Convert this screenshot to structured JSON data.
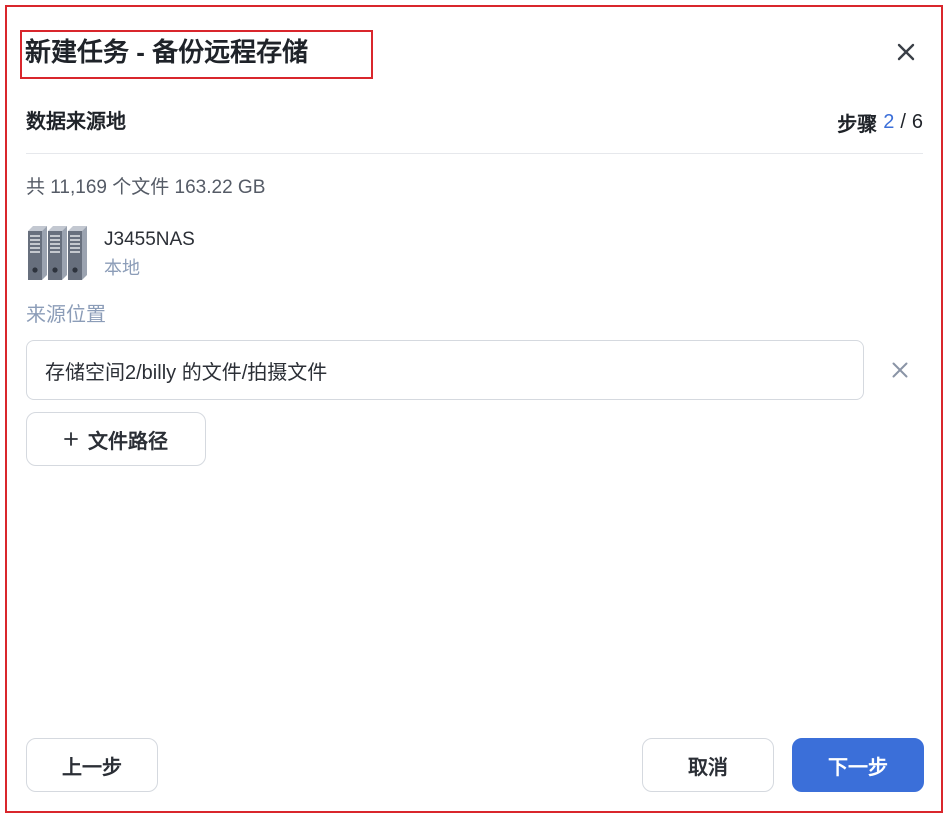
{
  "dialog": {
    "title": "新建任务 - 备份远程存储",
    "close_icon": "close-icon"
  },
  "section": {
    "title": "数据来源地",
    "step_label": "步骤",
    "step_current": "2",
    "step_separator": "/",
    "step_total": "6"
  },
  "summary": "共 11,169 个文件 163.22 GB",
  "device": {
    "icon": "nas-server-icon",
    "name": "J3455NAS",
    "type": "本地"
  },
  "source": {
    "label": "来源位置",
    "paths": [
      "存储空间2/billy 的文件/拍摄文件"
    ],
    "remove_icon": "close-icon",
    "add_icon": "plus-icon",
    "add_button": "文件路径"
  },
  "footer": {
    "back": "上一步",
    "cancel": "取消",
    "next": "下一步"
  },
  "colors": {
    "accent": "#3b6fd9",
    "highlight": "#d9262c",
    "muted": "#8c9db8"
  }
}
